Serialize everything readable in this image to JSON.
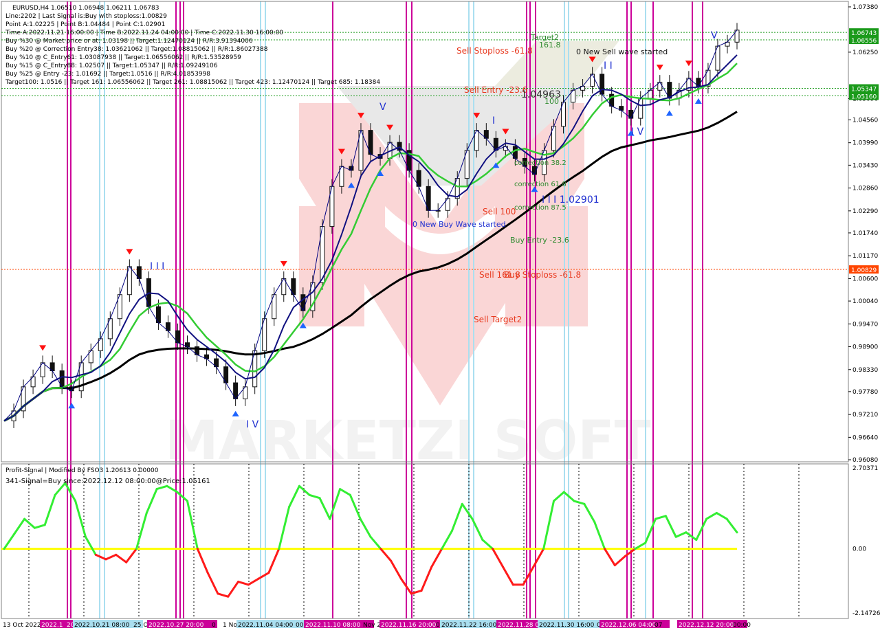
{
  "chart_data": [
    {
      "type": "line",
      "symbol_header": "EURUSD,H4  1.06510 1.06948 1.06211 1.06783",
      "info_lines": [
        "Line:2202 | Last Signal is:Buy with stoploss:1.00829",
        "Point A:1.02225 | Point B:1.04484 | Point C:1.02901",
        "Time A:2022.11.21 16:00:00 | Time B:2022.11.24 04:00:00 | Time C:2022.11.30 16:00:00",
        "Buy %30 @ Market price or at: 1.03198 || Target:1.12470124 || R/R:3.91394006",
        "Buy %20 @ Correction Entry38: 1.03621062 || Target:1.08815062 || R/R:1.86027388",
        "Buy %10 @ C_Entry61: 1.03087938 || Target:1.06556062 || R/R:1.53528959",
        "Buy %15 @ C_Entry88: 1.02507 || Target:1.05347 || R/R:1.09249106",
        "Buy %25 @ Entry -23: 1.01692 || Target:1.0516 || R/R:4.01853998",
        "Target100: 1.0516 || Target 161: 1.06556062 || Target 261: 1.08815062 || Target 423: 1.12470124 || Target 685: 1.18384"
      ],
      "y_axis_ticks": [
        "1.07380",
        "1.06250",
        "1.05090",
        "1.04560",
        "1.03990",
        "1.03430",
        "1.02860",
        "1.02290",
        "1.01740",
        "1.01170",
        "1.00600",
        "1.00040",
        "0.99470",
        "0.98900",
        "0.98330",
        "0.97780",
        "0.97210",
        "0.96640",
        "0.96080"
      ],
      "y_axis_values": [
        1.0738,
        1.0625,
        1.0509,
        1.0456,
        1.0399,
        1.0343,
        1.0286,
        1.0229,
        1.0174,
        1.0117,
        1.006,
        1.0004,
        0.9947,
        0.989,
        0.9833,
        0.9778,
        0.9721,
        0.9664,
        0.9608
      ],
      "ylim": [
        0.9608,
        1.0738
      ],
      "price_tags": [
        {
          "text": "1.06743",
          "value": 1.06743,
          "color": "#1a9a1a"
        },
        {
          "text": "1.06556",
          "value": 1.06556,
          "color": "#1a9a1a"
        },
        {
          "text": "1.05347",
          "value": 1.05347,
          "color": "#1a9a1a"
        },
        {
          "text": "1.05160",
          "value": 1.0516,
          "color": "#1a9a1a"
        },
        {
          "text": "1.00829",
          "value": 1.00829,
          "color": "#ff4500"
        }
      ],
      "annotations": [
        {
          "text": "Target2",
          "color": "#2e8b2e"
        },
        {
          "text": "161.8",
          "color": "#2e8b2e"
        },
        {
          "text": "Sell Stoploss -61.8",
          "color": "#e8391e"
        },
        {
          "text": "0 New Sell wave started",
          "color": "#111111"
        },
        {
          "text": "Sell Entry -23.6",
          "color": "#e8391e"
        },
        {
          "text": "1.04963",
          "color": "#333333"
        },
        {
          "text": "100",
          "color": "#2e8b2e"
        },
        {
          "text": "correction 38.2",
          "color": "#2e8b2e"
        },
        {
          "text": "correction 61.8",
          "color": "#2e8b2e"
        },
        {
          "text": "correction 87.5",
          "color": "#2e8b2e"
        },
        {
          "text": "I I I 1.02901",
          "color": "#2030d0"
        },
        {
          "text": "Sell 100",
          "color": "#e8391e"
        },
        {
          "text": "0 New Buy Wave started",
          "color": "#2030d0"
        },
        {
          "text": "Buy Entry -23.6",
          "color": "#2e8b2e"
        },
        {
          "text": "Sell 161.8",
          "color": "#e8391e"
        },
        {
          "text": "Buy Stoploss -61.8",
          "color": "#e8391e"
        },
        {
          "text": "Sell Target2",
          "color": "#e8391e"
        }
      ],
      "wave_labels": [
        "I I I",
        "I V",
        "V",
        "I",
        "I I",
        "I V",
        "V"
      ],
      "watermark": "MARKETZI SOFT",
      "colors": {
        "candles": "#111111",
        "ma_fast": "#000080",
        "ma_slow_blue": "#101080",
        "ma_green": "#33cc33",
        "ma_black": "#000000",
        "magenta_lines": "#cc0099",
        "cyan_lines": "#aadff0",
        "buy_arrow": "#1e64ff",
        "sell_arrow": "#ff1010"
      },
      "series": [
        {
          "name": "",
          "values": [
            0.9705,
            0.973,
            0.979,
            0.9815,
            0.985,
            0.983,
            0.979,
            0.978,
            0.985,
            0.988,
            0.991,
            0.996,
            1.002,
            1.009,
            1.006,
            0.999,
            0.995,
            0.993,
            0.99,
            0.989,
            0.987,
            0.986,
            0.984,
            0.98,
            0.976,
            0.979,
            0.988,
            0.996,
            1.002,
            1.006,
            1.002,
            0.998,
            1.005,
            1.019,
            1.029,
            1.034,
            1.033,
            1.043,
            1.037,
            1.036,
            1.04,
            1.038,
            1.033,
            1.029,
            1.023,
            1.023,
            1.026,
            1.031,
            1.038,
            1.043,
            1.041,
            1.038,
            1.039,
            1.036,
            1.034,
            1.032,
            1.038,
            1.044,
            1.05,
            1.053,
            1.054,
            1.057,
            1.052,
            1.049,
            1.048,
            1.046,
            1.051,
            1.053,
            1.055,
            1.051,
            1.053,
            1.056,
            1.054,
            1.058,
            1.064,
            1.065,
            1.068
          ]
        }
      ]
    },
    {
      "type": "line",
      "title": "Profit-Signal | Modified By FSO3 1.20613 0.00000",
      "signal_text": "341-Signal=Buy since:2022.12.12 08:00:00@Price:1.05161",
      "y_axis_ticks": [
        "2.70371",
        "0.00",
        "-2.14726"
      ],
      "ylim": [
        -2.14726,
        2.70371
      ],
      "zero_line_color": "#ffff00",
      "series": [
        {
          "name": "",
          "values": [
            0.0,
            0.5,
            1.0,
            0.7,
            0.8,
            1.8,
            2.2,
            1.6,
            0.4,
            -0.2,
            -0.35,
            -0.2,
            -0.45,
            0.0,
            1.2,
            2.0,
            2.1,
            1.9,
            1.6,
            0.0,
            -0.8,
            -1.5,
            -1.6,
            -1.1,
            -1.2,
            -1.0,
            -0.8,
            0.0,
            1.4,
            2.1,
            1.8,
            1.7,
            1.0,
            2.0,
            1.8,
            1.0,
            0.4,
            0.0,
            -0.4,
            -1.0,
            -1.5,
            -1.4,
            -0.6,
            0.0,
            0.6,
            1.5,
            1.0,
            0.3,
            0.0,
            -0.6,
            -1.2,
            -1.2,
            -0.6,
            0.0,
            1.6,
            1.9,
            1.6,
            1.5,
            0.9,
            0.0,
            -0.55,
            -0.25,
            0.0,
            0.2,
            1.0,
            1.1,
            0.4,
            0.55,
            0.3,
            1.0,
            1.2,
            1.0,
            0.55
          ]
        }
      ]
    }
  ],
  "x_axis_labels": [
    "13 Oct 2022",
    "2022.1",
    "20",
    "2022.10.21 08:00",
    "25 O",
    "2022.10.27 20:00",
    "0",
    "1 No",
    "2022.11.04 04:00",
    "00",
    "2022.11.10 08:00",
    "Nov 2",
    "2022.11.16 20:00",
    "0",
    "2022.11.22 16:00",
    "2022.11.28 0",
    "2022.11.30 16:00",
    "0",
    "2022.12.06 04:00",
    "07",
    "2022.12.12 20:00",
    "00:00"
  ],
  "x_tag_kinds": [
    "plain",
    "mag",
    "mag",
    "cyan",
    "plain",
    "mag",
    "plain",
    "plain",
    "cyan",
    "plain",
    "mag",
    "plain",
    "mag",
    "plain",
    "cyan",
    "mag",
    "cyan",
    "plain",
    "mag",
    "plain",
    "mag",
    "plain"
  ]
}
